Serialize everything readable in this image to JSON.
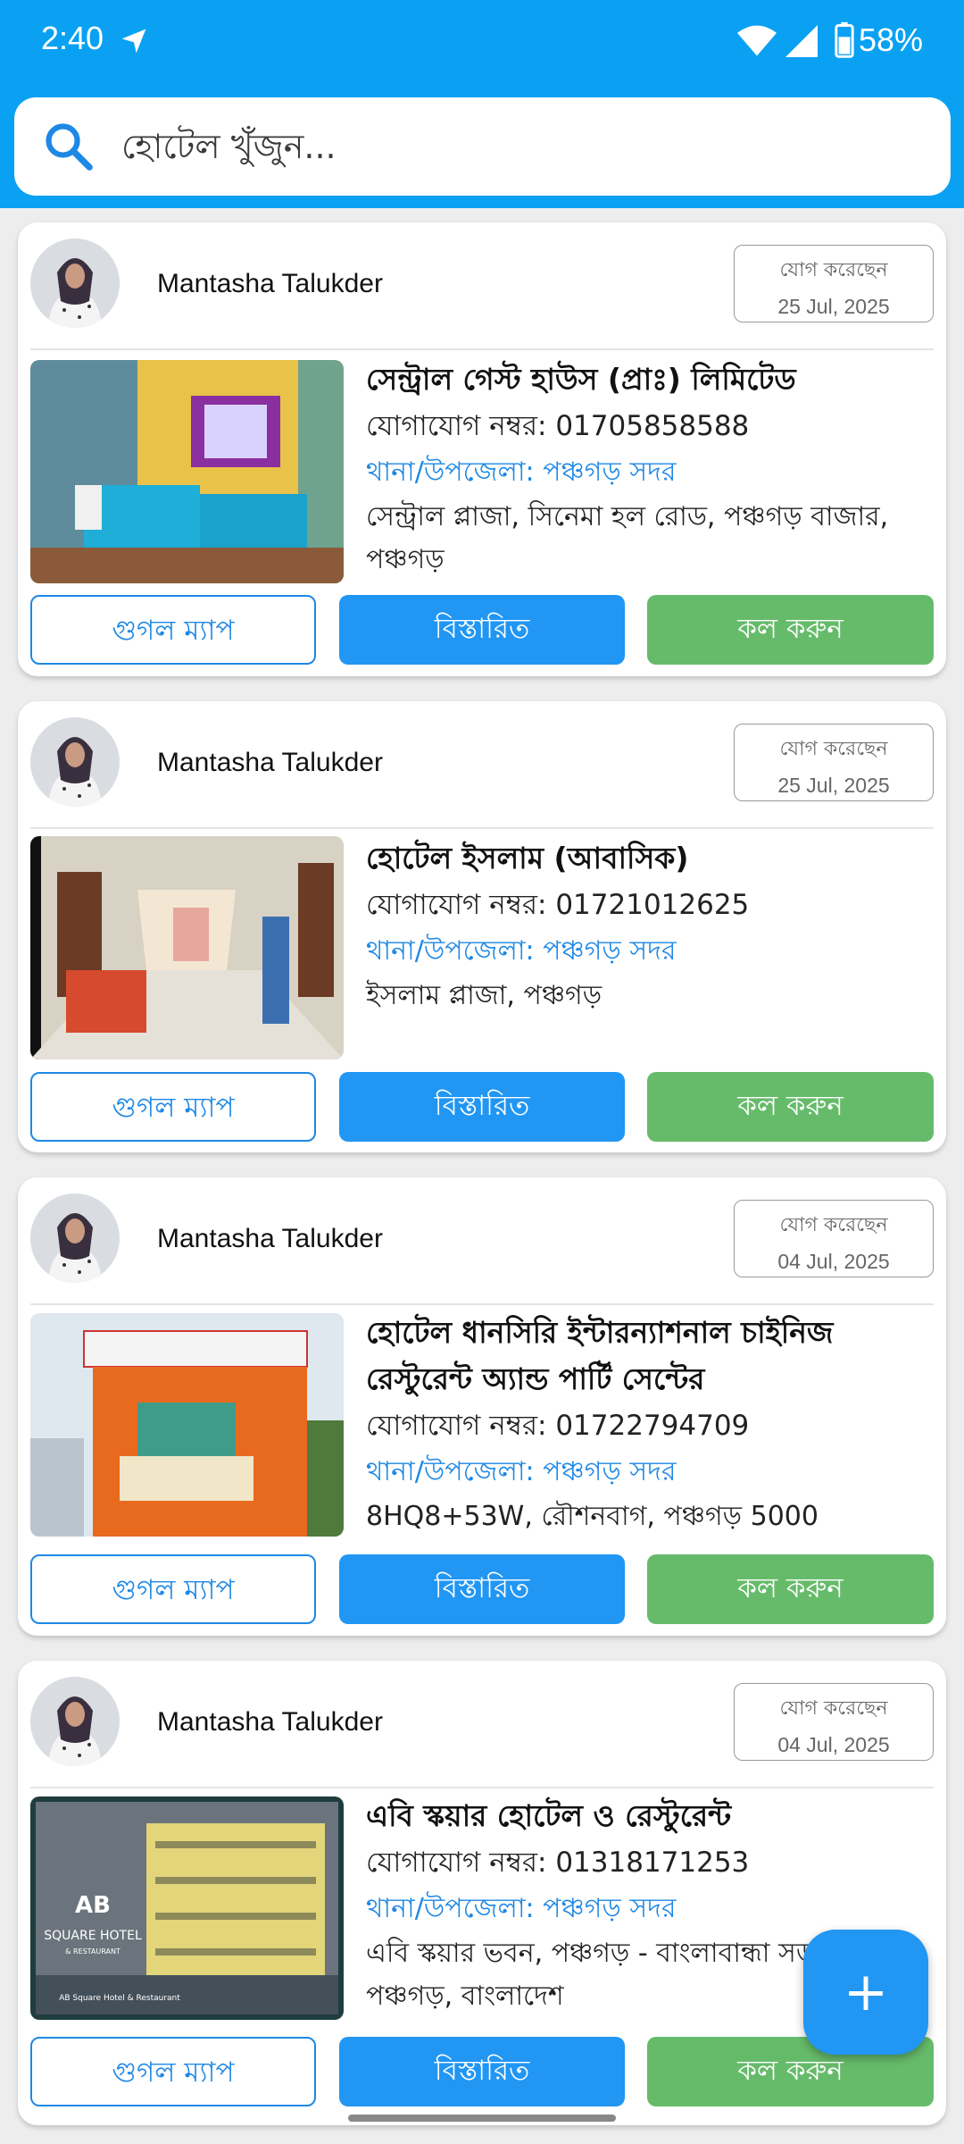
{
  "status_bar": {
    "time": "2:40",
    "battery": "58%"
  },
  "search": {
    "placeholder": "হোটেল খুঁজুন..."
  },
  "joined_label": "যোগ করেছেন",
  "buttons": {
    "map": "গুগল ম্যাপ",
    "details": "বিস্তারিত",
    "call": "কল করুন"
  },
  "cards": [
    {
      "user": "Mantasha Talukder",
      "joined_date": "25 Jul, 2025",
      "name": "সেন্ট্রাল গেস্ট হাউস (প্রাঃ) লিমিটেড",
      "phone": "যোগাযোগ নম্বর: 01705858588",
      "area": "থানা/উপজেলা: পঞ্চগড় সদর",
      "address": "সেন্ট্রাল প্লাজা, সিনেমা হল রোড, পঞ্চগড় বাজার, পঞ্চগড়"
    },
    {
      "user": "Mantasha Talukder",
      "joined_date": "25 Jul, 2025",
      "name": "হোটেল ইসলাম (আবাসিক)",
      "phone": "যোগাযোগ নম্বর: 01721012625",
      "area": "থানা/উপজেলা: পঞ্চগড় সদর",
      "address": "ইসলাম প্লাজা, পঞ্চগড়"
    },
    {
      "user": "Mantasha Talukder",
      "joined_date": "04 Jul, 2025",
      "name": "হোটেল ধানসিরি ইন্টারন্যাশনাল চাইনিজ রেস্টুরেন্ট অ্যান্ড পার্টি সেন্টের",
      "phone": "যোগাযোগ নম্বর: 01722794709",
      "area": "থানা/উপজেলা: পঞ্চগড় সদর",
      "address": "8HQ8+53W, রৌশনবাগ, পঞ্চগড় 5000"
    },
    {
      "user": "Mantasha Talukder",
      "joined_date": "04 Jul, 2025",
      "name": "এবি স্কয়ার হোটেল ও রেস্টুরেন্ট",
      "phone": "যোগাযোগ নম্বর: 01318171253",
      "area": "থানা/উপজেলা: পঞ্চগড় সদর",
      "address": "এবি স্কয়ার ভবন, পঞ্চগড় - বাংলাবান্ধা সড়ক, পঞ্চগড়, বাংলাদেশ"
    }
  ],
  "photo_sign": {
    "line1": "AB",
    "line2": "SQUARE HOTEL",
    "line3": "& RESTAURANT",
    "line4": "AB Square Hotel & Restaurant"
  },
  "fab": {
    "label": "+"
  }
}
